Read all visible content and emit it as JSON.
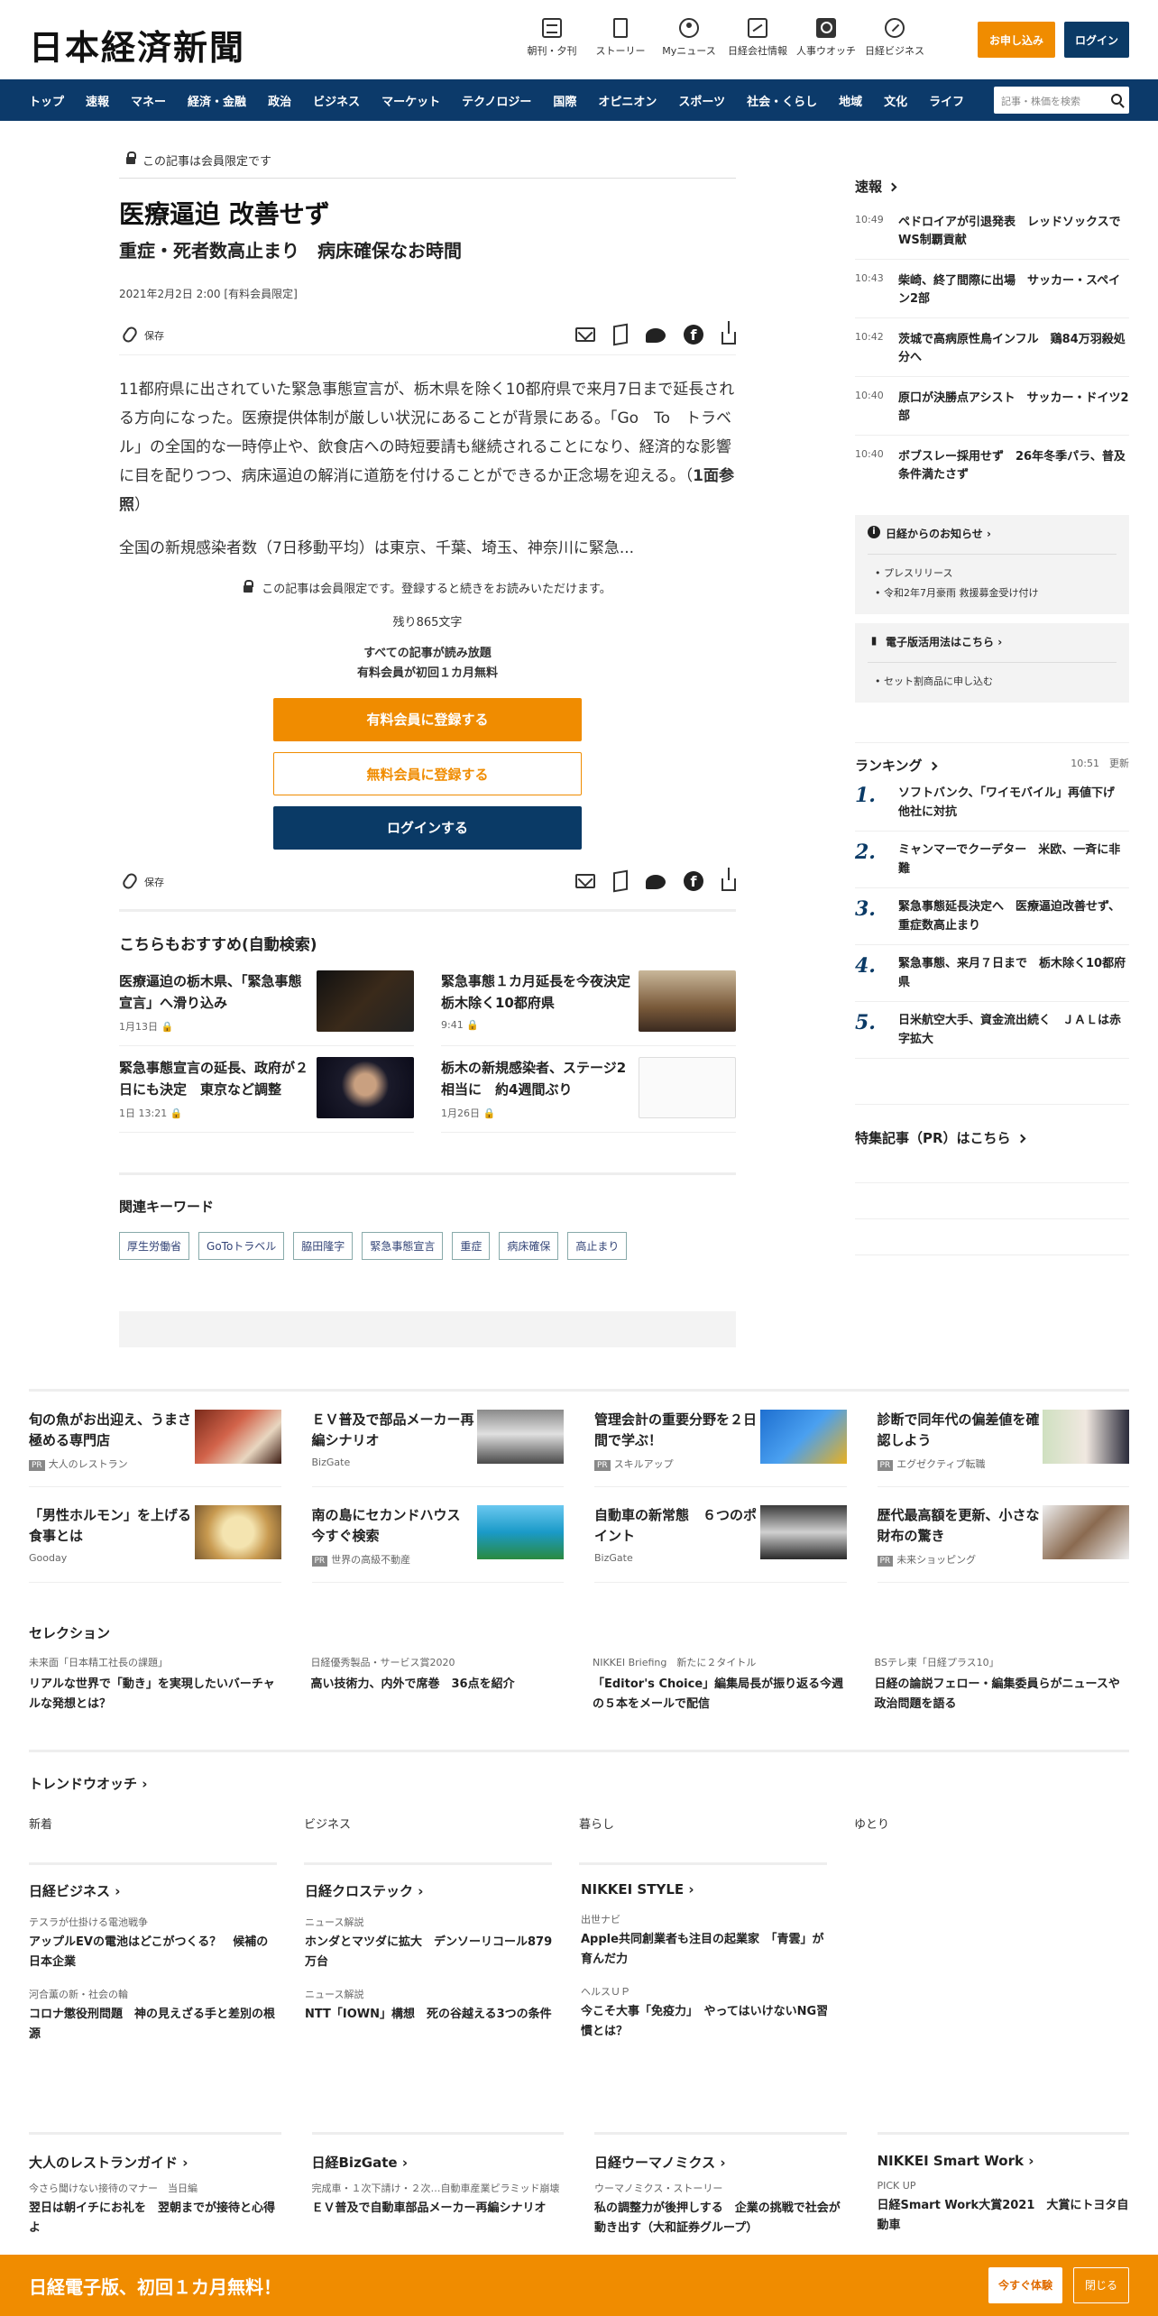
{
  "header": {
    "logo": "日本経済新聞",
    "nav": [
      {
        "label": "朝刊・夕刊",
        "icon": "newspaper-icon"
      },
      {
        "label": "ストーリー",
        "icon": "story-icon"
      },
      {
        "label": "Myニュース",
        "icon": "user-icon"
      },
      {
        "label": "日経会社情報",
        "icon": "chart-icon"
      },
      {
        "label": "人事ウオッチ",
        "icon": "search-person-icon"
      },
      {
        "label": "日経ビジネス",
        "icon": "compass-icon"
      }
    ],
    "apply": "お申し込み",
    "login": "ログイン"
  },
  "gnav": {
    "items": [
      "トップ",
      "速報",
      "マネー",
      "経済・金融",
      "政治",
      "ビジネス",
      "マーケット",
      "テクノロジー",
      "国際",
      "オピニオン",
      "スポーツ",
      "社会・くらし",
      "地域",
      "文化",
      "ライフ"
    ],
    "search_placeholder": "記事・株価を検索"
  },
  "article": {
    "member_only": "この記事は会員限定です",
    "title": "医療逼迫 改善せず",
    "subtitle": "重症・死者数高止まり　病床確保なお時間",
    "date": "2021年2月2日 2:00 [有料会員限定]",
    "save": "保存",
    "para1": "11都府県に出されていた緊急事態宣言が、栃木県を除く10都府県で来月7日まで延長される方向になった。医療提供体制が厳しい状況にあることが背景にある。「Go　To　トラベル」の全国的な一時停止や、飲食店への時短要請も継続されることになり、経済的な影響に目を配りつつ、病床逼迫の解消に道筋を付けることができるか正念場を迎える。（",
    "para1_ref": "1面参照",
    "para1_end": "）",
    "para2": "全国の新規感染者数（7日移動平均）は東京、千葉、埼玉、神奈川に緊急...",
    "wall_msg": "この記事は会員限定です。登録すると続きをお読みいただけます。",
    "remaining": "残り865文字",
    "offer1": "すべての記事が読み放題",
    "offer2": "有料会員が初回１カ月無料",
    "btn_paid": "有料会員に登録する",
    "btn_free": "無料会員に登録する",
    "btn_login": "ログインする"
  },
  "recommend": {
    "heading": "こちらもおすすめ(自動検索)",
    "items": [
      {
        "title": "医療逼迫の栃木県、「緊急事態宣言」へ滑り込み",
        "date": "1月13日"
      },
      {
        "title": "緊急事態１カ月延長を今夜決定　栃木除く10都府県",
        "date": "9:41"
      },
      {
        "title": "緊急事態宣言の延長、政府が２日にも決定　東京など調整",
        "date": "1日 13:21"
      },
      {
        "title": "栃木の新規感染者、ステージ2相当に　約4週間ぶり",
        "date": "1月26日"
      }
    ]
  },
  "keywords": {
    "heading": "関連キーワード",
    "items": [
      "厚生労働省",
      "GoToトラベル",
      "脇田隆字",
      "緊急事態宣言",
      "重症",
      "病床確保",
      "高止まり"
    ]
  },
  "sidebar": {
    "sokuho_title": "速報",
    "sokuho": [
      {
        "time": "10:49",
        "text": "ペドロイアが引退発表　レッドソックスでWS制覇貢献"
      },
      {
        "time": "10:43",
        "text": "柴崎、終了間際に出場　サッカー・スペイン2部"
      },
      {
        "time": "10:42",
        "text": "茨城で高病原性鳥インフル　鶏84万羽殺処分へ"
      },
      {
        "time": "10:40",
        "text": "原口が決勝点アシスト　サッカー・ドイツ2部"
      },
      {
        "time": "10:40",
        "text": "ボブスレー採用せず　26年冬季パラ、普及条件満たさず"
      }
    ],
    "notice1_title": "日経からのお知らせ",
    "notice1": [
      "プレスリリース",
      "令和2年7月豪雨 救援募金受け付け"
    ],
    "notice2_title": "電子版活用法はこちら",
    "notice2": [
      "セット割商品に申し込む"
    ],
    "ranking_title": "ランキング",
    "ranking_updated": "10:51　更新",
    "ranking": [
      {
        "no": "1.",
        "text": "ソフトバンク、「ワイモバイル」再値下げ　他社に対抗"
      },
      {
        "no": "2.",
        "text": "ミャンマーでクーデター　米欧、一斉に非難"
      },
      {
        "no": "3.",
        "text": "緊急事態延長決定へ　医療逼迫改善せず、重症数高止まり"
      },
      {
        "no": "4.",
        "text": "緊急事態、来月７日まで　栃木除く10都府県"
      },
      {
        "no": "5.",
        "text": "日米航空大手、資金流出続く　ＪＡＬは赤字拡大"
      }
    ],
    "pr_title": "特集記事（PR）はこちら"
  },
  "promo": [
    {
      "title": "旬の魚がお出迎え、うまさ極める専門店",
      "sponsor": "大人のレストラン",
      "pr": true
    },
    {
      "title": "ＥＶ普及で部品メーカー再編シナリオ",
      "sponsor": "BizGate",
      "pr": false
    },
    {
      "title": "管理会計の重要分野を２日間で学ぶ！",
      "sponsor": "スキルアップ",
      "pr": true
    },
    {
      "title": "診断で同年代の偏差値を確認しよう",
      "sponsor": "エグゼクティブ転職",
      "pr": true
    },
    {
      "title": "「男性ホルモン」を上げる食事とは",
      "sponsor": "Gooday",
      "pr": false
    },
    {
      "title": "南の島にセカンドハウス　今すぐ検索",
      "sponsor": "世界の高級不動産",
      "pr": true
    },
    {
      "title": "自動車の新常態　６つのポイント",
      "sponsor": "BizGate",
      "pr": false
    },
    {
      "title": "歴代最高額を更新、小さな財布の驚き",
      "sponsor": "未来ショッピング",
      "pr": true
    }
  ],
  "pr_label": "PR",
  "selection": {
    "heading": "セレクション",
    "items": [
      {
        "kicker": "未来面「日本精工社長の課題」",
        "title": "リアルな世界で「動き」を実現したいバーチャルな発想とは？"
      },
      {
        "kicker": "日経優秀製品・サービス賞2020",
        "title": "高い技術力、内外で席巻　36点を紹介"
      },
      {
        "kicker": "NIKKEI Briefing　新たに２タイトル",
        "title": "「Editor's Choice」編集局長が振り返る今週の５本をメールで配信"
      },
      {
        "kicker": "BSテレ東「日経プラス10」",
        "title": "日経の論説フェロー・編集委員らがニュースや政治問題を語る"
      }
    ]
  },
  "trend": {
    "heading": "トレンドウオッチ",
    "cols": [
      "新着",
      "ビジネス",
      "暮らし",
      "ゆとり"
    ]
  },
  "mags": [
    {
      "name": "日経ビジネス",
      "items": [
        {
          "k": "テスラが仕掛ける電池戦争",
          "t": "アップルEVの電池はどこがつくる？　候補の日本企業"
        },
        {
          "k": "河合薫の新・社会の輪",
          "t": "コロナ懲役刑問題　神の見えざる手と差別の根源"
        }
      ]
    },
    {
      "name": "日経クロステック",
      "items": [
        {
          "k": "ニュース解説",
          "t": "ホンダとマツダに拡大　デンソーリコール879万台"
        },
        {
          "k": "ニュース解説",
          "t": "NTT「IOWN」構想　死の谷越える3つの条件"
        }
      ]
    },
    {
      "name": "NIKKEI STYLE",
      "items": [
        {
          "k": "出世ナビ",
          "t": "Apple共同創業者も注目の起業家　「青雲」が育んだ力"
        },
        {
          "k": "ヘルスＵＰ",
          "t": "今こそ大事「免疫力」　やってはいけないNG習慣とは？"
        }
      ]
    }
  ],
  "bottom": [
    {
      "name": "大人のレストランガイド",
      "k": "今さら聞けない接待のマナー　当日編",
      "t": "翌日は朝イチにお礼を　翌朝までが接待と心得よ"
    },
    {
      "name": "日経BizGate",
      "k": "完成車・１次下請け・２次…自動車産業ピラミッド崩壊",
      "t": "ＥＶ普及で自動車部品メーカー再編シナリオ"
    },
    {
      "name": "日経ウーマノミクス",
      "k": "ウーマノミクス・ストーリー",
      "t": "私の調整力が後押しする　企業の挑戦で社会が動き出す（大和証券グループ）"
    },
    {
      "name": "NIKKEI Smart Work",
      "k": "PICK UP",
      "t": "日経Smart Work大賞2021　大賞にトヨタ自動車"
    }
  ],
  "banner": {
    "text": "日経電子版、初回１カ月無料！",
    "try": "今すぐ体験",
    "close": "閉じる"
  },
  "colors": {
    "navy": "#0c3a6a",
    "orange": "#f08c00"
  }
}
